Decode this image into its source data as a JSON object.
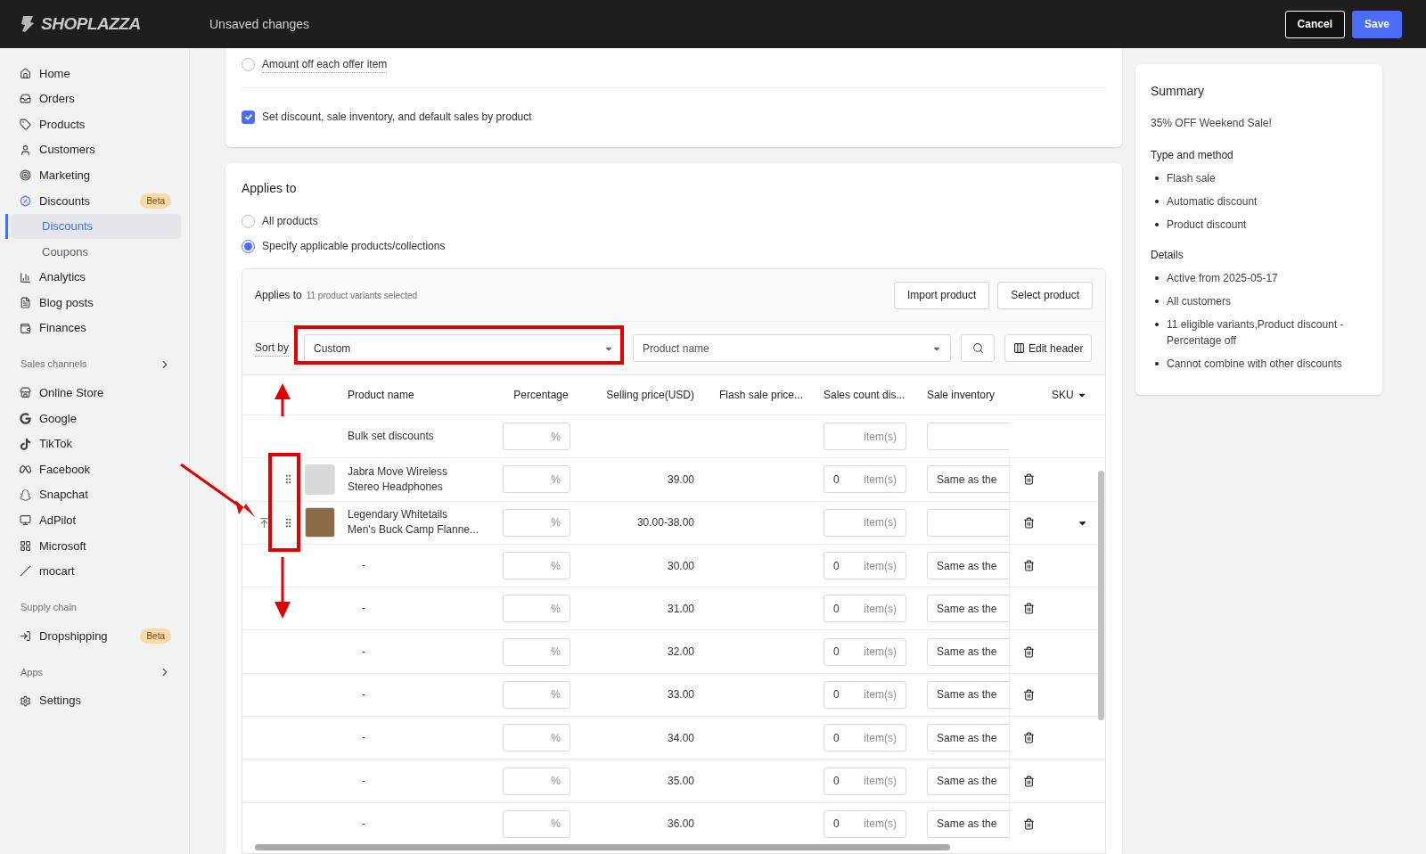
{
  "topbar": {
    "logo": "SHOPLAZZA",
    "title": "Unsaved changes",
    "buttons": [
      {
        "label": "Cancel",
        "kind": "secondary"
      },
      {
        "label": "Save",
        "kind": "primary"
      }
    ]
  },
  "sidebar": {
    "items": [
      {
        "kind": "link",
        "label": "Home",
        "selected": false
      },
      {
        "kind": "link",
        "label": "Orders",
        "selected": false
      },
      {
        "kind": "link",
        "label": "Products",
        "selected": false
      },
      {
        "kind": "link",
        "label": "Customers",
        "selected": false
      },
      {
        "kind": "link",
        "label": "Marketing",
        "selected": false
      },
      {
        "kind": "link",
        "label": "Discounts",
        "selected": false,
        "active_parent": true,
        "badge": "Beta"
      },
      {
        "kind": "sublink",
        "label": "Discounts",
        "selected": true
      },
      {
        "kind": "sublink",
        "label": "Coupons",
        "selected": false
      },
      {
        "kind": "link",
        "label": "Analytics",
        "selected": false
      },
      {
        "kind": "link",
        "label": "Blog posts",
        "selected": false
      },
      {
        "kind": "link",
        "label": "Finances",
        "selected": false
      },
      {
        "kind": "heading",
        "label": "Sales channels",
        "expandable": true
      },
      {
        "kind": "link",
        "label": "Online Store",
        "selected": false
      },
      {
        "kind": "link",
        "label": "Google",
        "selected": false
      },
      {
        "kind": "link",
        "label": "TikTok",
        "selected": false
      },
      {
        "kind": "link",
        "label": "Facebook",
        "selected": false
      },
      {
        "kind": "link",
        "label": "Snapchat",
        "selected": false
      },
      {
        "kind": "link",
        "label": "AdPilot",
        "selected": false
      },
      {
        "kind": "link",
        "label": "Microsoft",
        "selected": false
      },
      {
        "kind": "link",
        "label": "mocart",
        "selected": false
      },
      {
        "kind": "heading",
        "label": "Supply chain",
        "expandable": false
      },
      {
        "kind": "link",
        "label": "Dropshipping",
        "selected": false,
        "badge": "Beta"
      },
      {
        "kind": "heading",
        "label": "Apps",
        "expandable": true
      },
      {
        "kind": "link",
        "label": "Settings",
        "selected": false
      }
    ]
  },
  "method_card": {
    "radio": {
      "label": "Amount off each offer item",
      "selected": false
    },
    "checkbox": {
      "label": "Set discount, sale inventory, and default sales by product",
      "checked": true
    }
  },
  "applies_card": {
    "title": "Applies to",
    "options": [
      {
        "label": "All products",
        "selected": false
      },
      {
        "label": "Specify applicable products/collections",
        "selected": true
      }
    ],
    "panel": {
      "title": "Applies to",
      "count": "11 product variants selected",
      "buttons": [
        "Import product",
        "Select product"
      ],
      "sort_label": "Sort by",
      "sort_value": "Custom",
      "filter_value": "Product name",
      "edit_header": "Edit header",
      "columns": [
        {
          "label": "Product name",
          "dropdown": false
        },
        {
          "label": "Percentage",
          "dropdown": false
        },
        {
          "label": "Selling price(USD)",
          "dropdown": false
        },
        {
          "label": "Flash sale price...",
          "dropdown": false
        },
        {
          "label": "Sales count dis...",
          "dropdown": false
        },
        {
          "label": "Sale inventory",
          "dropdown": false
        },
        {
          "label": "SKU",
          "dropdown": true
        }
      ],
      "rows": [
        {
          "kind": "bulk",
          "name_lines": [
            "Bulk set discounts"
          ],
          "percent_unit": "%",
          "count_unit": "item(s)"
        },
        {
          "kind": "product",
          "name_lines": [
            "Jabra Move Wireless",
            "Stereo Headphones"
          ],
          "percent_unit": "%",
          "price": "39.00",
          "count": "0",
          "count_unit": "item(s)",
          "inventory": "Same as the",
          "hovered": false,
          "expandable": false
        },
        {
          "kind": "product",
          "name_lines": [
            "Legendary Whitetails",
            "Men's Buck Camp Flanne..."
          ],
          "percent_unit": "%",
          "price": "30.00-38.00",
          "count_unit": "item(s)",
          "hovered": true,
          "expandable": true
        },
        {
          "kind": "variant",
          "name_lines": [
            "-"
          ],
          "percent_unit": "%",
          "price": "30.00",
          "count": "0",
          "count_unit": "item(s)",
          "inventory": "Same as the"
        },
        {
          "kind": "variant",
          "name_lines": [
            "-"
          ],
          "percent_unit": "%",
          "price": "31.00",
          "count": "0",
          "count_unit": "item(s)",
          "inventory": "Same as the"
        },
        {
          "kind": "variant",
          "name_lines": [
            "-"
          ],
          "percent_unit": "%",
          "price": "32.00",
          "count": "0",
          "count_unit": "item(s)",
          "inventory": "Same as the"
        },
        {
          "kind": "variant",
          "name_lines": [
            "-"
          ],
          "percent_unit": "%",
          "price": "33.00",
          "count": "0",
          "count_unit": "item(s)",
          "inventory": "Same as the"
        },
        {
          "kind": "variant",
          "name_lines": [
            "-"
          ],
          "percent_unit": "%",
          "price": "34.00",
          "count": "0",
          "count_unit": "item(s)",
          "inventory": "Same as the"
        },
        {
          "kind": "variant",
          "name_lines": [
            "-"
          ],
          "percent_unit": "%",
          "price": "35.00",
          "count": "0",
          "count_unit": "item(s)",
          "inventory": "Same as the"
        },
        {
          "kind": "variant",
          "name_lines": [
            "-"
          ],
          "percent_unit": "%",
          "price": "36.00",
          "count": "0",
          "count_unit": "item(s)",
          "inventory": "Same as the"
        }
      ]
    }
  },
  "summary": {
    "title": "Summary",
    "name": "35% OFF Weekend Sale!",
    "sections": [
      {
        "heading": "Type and method",
        "items": [
          "Flash sale",
          "Automatic discount",
          "Product discount"
        ]
      },
      {
        "heading": "Details",
        "items": [
          "Active from 2025-05-17",
          "All customers",
          "11 eligible variants,Product discount - Percentage off",
          "Cannot combine with other discounts"
        ]
      }
    ]
  }
}
